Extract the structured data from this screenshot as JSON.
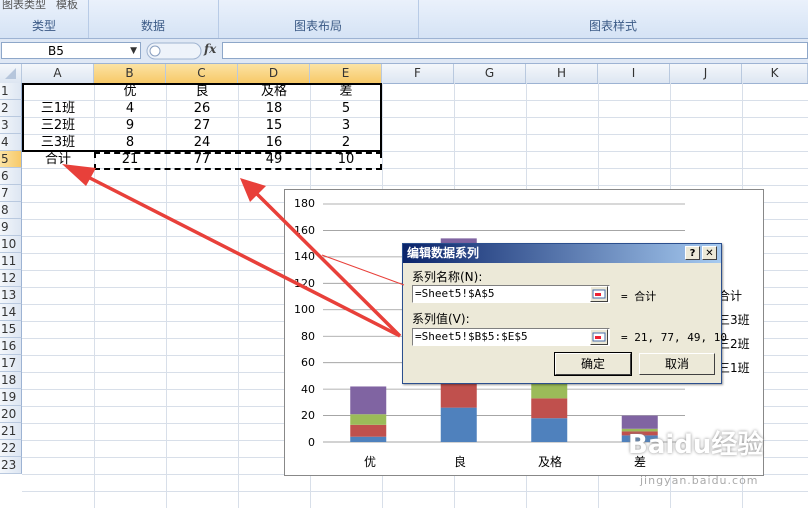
{
  "ribbon": {
    "groups": [
      "类型",
      "数据",
      "图表布局",
      "图表样式"
    ],
    "cutoff_buttons": [
      "图表类型",
      "模板"
    ]
  },
  "formula_bar": {
    "name_box": "B5",
    "fx_label": "fx"
  },
  "columns": [
    "A",
    "B",
    "C",
    "D",
    "E",
    "F",
    "G",
    "H",
    "I",
    "J",
    "K"
  ],
  "rows": [
    "1",
    "2",
    "3",
    "4",
    "5",
    "6",
    "7",
    "8",
    "9",
    "10",
    "11",
    "12",
    "13",
    "14",
    "15",
    "16",
    "17",
    "18",
    "19",
    "20",
    "21",
    "22",
    "23"
  ],
  "table": {
    "header": [
      "",
      "优",
      "良",
      "及格",
      "差"
    ],
    "rows": [
      [
        "三1班",
        "4",
        "26",
        "18",
        "5"
      ],
      [
        "三2班",
        "9",
        "27",
        "15",
        "3"
      ],
      [
        "三3班",
        "8",
        "24",
        "16",
        "2"
      ],
      [
        "合计",
        "21",
        "77",
        "49",
        "10"
      ]
    ]
  },
  "chart_data": {
    "type": "bar",
    "stacked": true,
    "categories": [
      "优",
      "良",
      "及格",
      "差"
    ],
    "series": [
      {
        "name": "三1班",
        "values": [
          4,
          26,
          18,
          5
        ],
        "color": "#4f81bd"
      },
      {
        "name": "三2班",
        "values": [
          9,
          27,
          15,
          3
        ],
        "color": "#c0504d"
      },
      {
        "name": "三3班",
        "values": [
          8,
          24,
          16,
          2
        ],
        "color": "#9bbb59"
      },
      {
        "name": "合计",
        "values": [
          21,
          77,
          49,
          10
        ],
        "color": "#8064a2"
      }
    ],
    "ylim": [
      0,
      180
    ],
    "yticks": [
      "0",
      "20",
      "40",
      "60",
      "80",
      "100",
      "120",
      "140",
      "160",
      "180"
    ],
    "legend_position": "right",
    "legend_visible": [
      "合计",
      "三3班",
      "三2班",
      "三1班"
    ],
    "grid": true
  },
  "dialog": {
    "title": "编辑数据系列",
    "help_btn": "?",
    "close_btn": "✕",
    "name_label": "系列名称(N):",
    "name_value": "=Sheet5!$A$5",
    "name_preview": "= 合计",
    "values_label": "系列值(V):",
    "values_value": "=Sheet5!$B$5:$E$5",
    "values_preview": "= 21, 77, 49, 10",
    "ok": "确定",
    "cancel": "取消"
  },
  "watermark": {
    "brand": "Baidu经验",
    "url": "jingyan.baidu.com"
  },
  "colors": {
    "arrow": "#e8403a",
    "selection_header": "#f7c968"
  }
}
